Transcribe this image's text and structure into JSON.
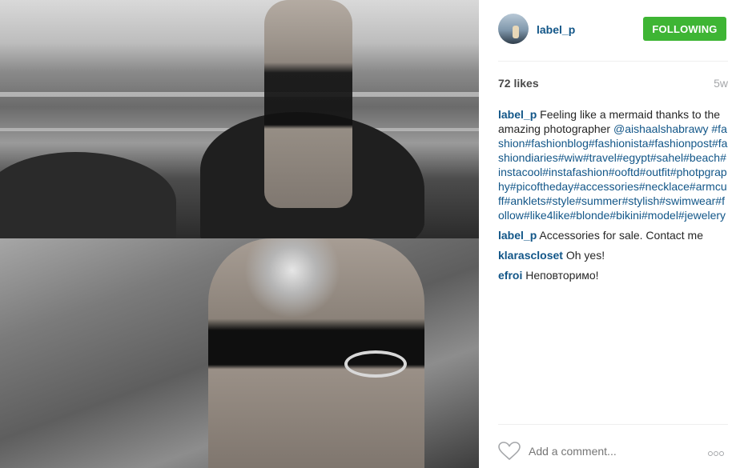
{
  "post": {
    "username": "label_p",
    "follow_label": "FOLLOWING",
    "likes": "72 likes",
    "time": "5w"
  },
  "comments": [
    {
      "user": "label_p",
      "text": "Feeling like a mermaid thanks to the amazing photographer",
      "mention": "@aishaalshabrawy",
      "tags": "#fashion#fashionblog#fashionista#fashionpost#fashiondiaries#wiw#travel#egypt#sahel#beach#instacool#instafashion#ooftd#outfit#photpgraphy#picoftheday#accessories#necklace#armcuff#anklets#style#summer#stylish#swimwear#follow#like4like#blonde#bikini#model#jewelery"
    },
    {
      "user": "label_p",
      "text": "Accessories for sale. Contact me"
    },
    {
      "user": "klarascloset",
      "text": "Oh yes!"
    },
    {
      "user": "efroi",
      "text": "Неповторимо!"
    }
  ],
  "footer": {
    "comment_placeholder": "Add a comment...",
    "like_icon": "heart-icon",
    "more_icon": "more-options-icon"
  },
  "colors": {
    "follow_button": "#3eb534",
    "username": "#125688",
    "muted": "#a5a7aa"
  }
}
